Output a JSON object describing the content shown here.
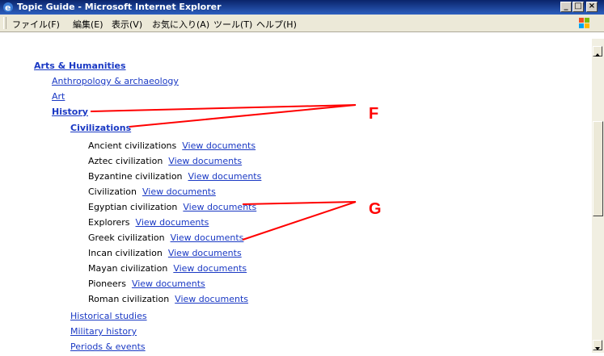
{
  "window": {
    "title": "Topic Guide - Microsoft Internet Explorer",
    "buttons": [
      "_",
      "□",
      "×"
    ]
  },
  "menu": [
    "ファイル(F)",
    "編集(E)",
    "表示(V)",
    "お気に入り(A)",
    "ツール(T)",
    "ヘルプ(H)"
  ],
  "tree": {
    "category": "Arts & Humanities",
    "level1_top": [
      "Anthropology & archaeology",
      "Art"
    ],
    "history": "History",
    "civilizations": "Civilizations",
    "items": [
      "Ancient civilizations",
      "Aztec civilization",
      "Byzantine civilization",
      "Civilization",
      "Egyptian civilization",
      "Explorers",
      "Greek civilization",
      "Incan civilization",
      "Mayan civilization",
      "Pioneers",
      "Roman civilization"
    ],
    "view_label": "View documents",
    "level1_bottom": [
      "Historical studies",
      "Military history",
      "Periods & events"
    ]
  },
  "annotations": {
    "f": "F",
    "g": "G",
    "color": "#ff0000"
  }
}
